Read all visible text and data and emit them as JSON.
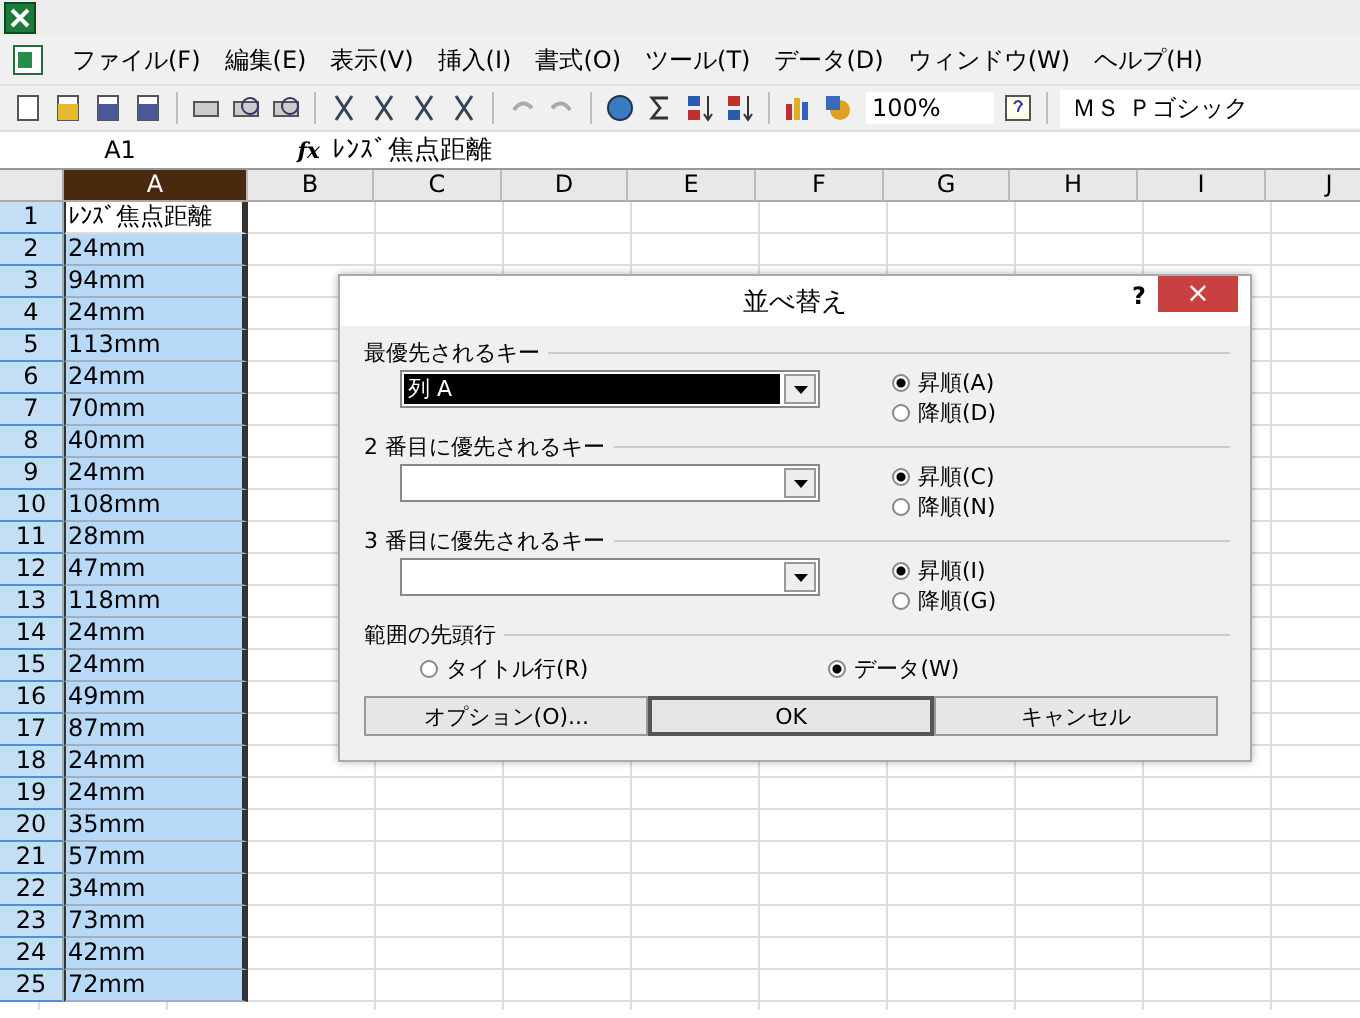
{
  "menu": {
    "items": [
      {
        "label": "ファイル(F)"
      },
      {
        "label": "編集(E)"
      },
      {
        "label": "表示(V)"
      },
      {
        "label": "挿入(I)"
      },
      {
        "label": "書式(O)"
      },
      {
        "label": "ツール(T)"
      },
      {
        "label": "データ(D)"
      },
      {
        "label": "ウィンドウ(W)"
      },
      {
        "label": "ヘルプ(H)"
      }
    ]
  },
  "toolbar": {
    "zoom": "100%",
    "font": "ＭＳ Ｐゴシック"
  },
  "formula_bar": {
    "name_box": "A1",
    "fx": "fx",
    "value": "ﾚﾝｽﾞ焦点距離"
  },
  "columns": [
    {
      "label": "A",
      "selected": true
    },
    {
      "label": "B",
      "selected": false
    },
    {
      "label": "C",
      "selected": false
    },
    {
      "label": "D",
      "selected": false
    },
    {
      "label": "E",
      "selected": false
    },
    {
      "label": "F",
      "selected": false
    },
    {
      "label": "G",
      "selected": false
    },
    {
      "label": "H",
      "selected": false
    },
    {
      "label": "I",
      "selected": false
    },
    {
      "label": "J",
      "selected": false
    }
  ],
  "rows": [
    {
      "number": "1",
      "column_a": "ﾚﾝｽﾞ焦点距離",
      "active": true
    },
    {
      "number": "2",
      "column_a": "24mm",
      "active": false
    },
    {
      "number": "3",
      "column_a": "94mm",
      "active": false
    },
    {
      "number": "4",
      "column_a": "24mm",
      "active": false
    },
    {
      "number": "5",
      "column_a": "113mm",
      "active": false
    },
    {
      "number": "6",
      "column_a": "24mm",
      "active": false
    },
    {
      "number": "7",
      "column_a": "70mm",
      "active": false
    },
    {
      "number": "8",
      "column_a": "40mm",
      "active": false
    },
    {
      "number": "9",
      "column_a": "24mm",
      "active": false
    },
    {
      "number": "10",
      "column_a": "108mm",
      "active": false
    },
    {
      "number": "11",
      "column_a": "28mm",
      "active": false
    },
    {
      "number": "12",
      "column_a": "47mm",
      "active": false
    },
    {
      "number": "13",
      "column_a": "118mm",
      "active": false
    },
    {
      "number": "14",
      "column_a": "24mm",
      "active": false
    },
    {
      "number": "15",
      "column_a": "24mm",
      "active": false
    },
    {
      "number": "16",
      "column_a": "49mm",
      "active": false
    },
    {
      "number": "17",
      "column_a": "87mm",
      "active": false
    },
    {
      "number": "18",
      "column_a": "24mm",
      "active": false
    },
    {
      "number": "19",
      "column_a": "24mm",
      "active": false
    },
    {
      "number": "20",
      "column_a": "35mm",
      "active": false
    },
    {
      "number": "21",
      "column_a": "57mm",
      "active": false
    },
    {
      "number": "22",
      "column_a": "34mm",
      "active": false
    },
    {
      "number": "23",
      "column_a": "73mm",
      "active": false
    },
    {
      "number": "24",
      "column_a": "42mm",
      "active": false
    },
    {
      "number": "25",
      "column_a": "72mm",
      "active": false
    }
  ],
  "dialog": {
    "title": "並べ替え",
    "help": "?",
    "close": "×",
    "keys": [
      {
        "label": "最優先されるキー",
        "value": "列 A",
        "highlighted": true,
        "options": [
          {
            "label": "昇順(A)",
            "selected": true
          },
          {
            "label": "降順(D)",
            "selected": false
          }
        ]
      },
      {
        "label": "2 番目に優先されるキー",
        "highlighted": false,
        "options": [
          {
            "label": "昇順(C)",
            "selected": true
          },
          {
            "label": "降順(N)",
            "selected": false
          }
        ]
      },
      {
        "label": "3 番目に優先されるキー",
        "highlighted": false,
        "options": [
          {
            "label": "昇順(I)",
            "selected": true
          },
          {
            "label": "降順(G)",
            "selected": false
          }
        ]
      }
    ],
    "header_row": {
      "label": "範囲の先頭行",
      "options": [
        {
          "label": "タイトル行(R)",
          "selected": false
        },
        {
          "label": "データ(W)",
          "selected": true
        }
      ]
    },
    "buttons": [
      {
        "label": "オプション(O)...",
        "default": false
      },
      {
        "label": "OK",
        "default": true
      },
      {
        "label": "キャンセル",
        "default": false
      }
    ]
  }
}
